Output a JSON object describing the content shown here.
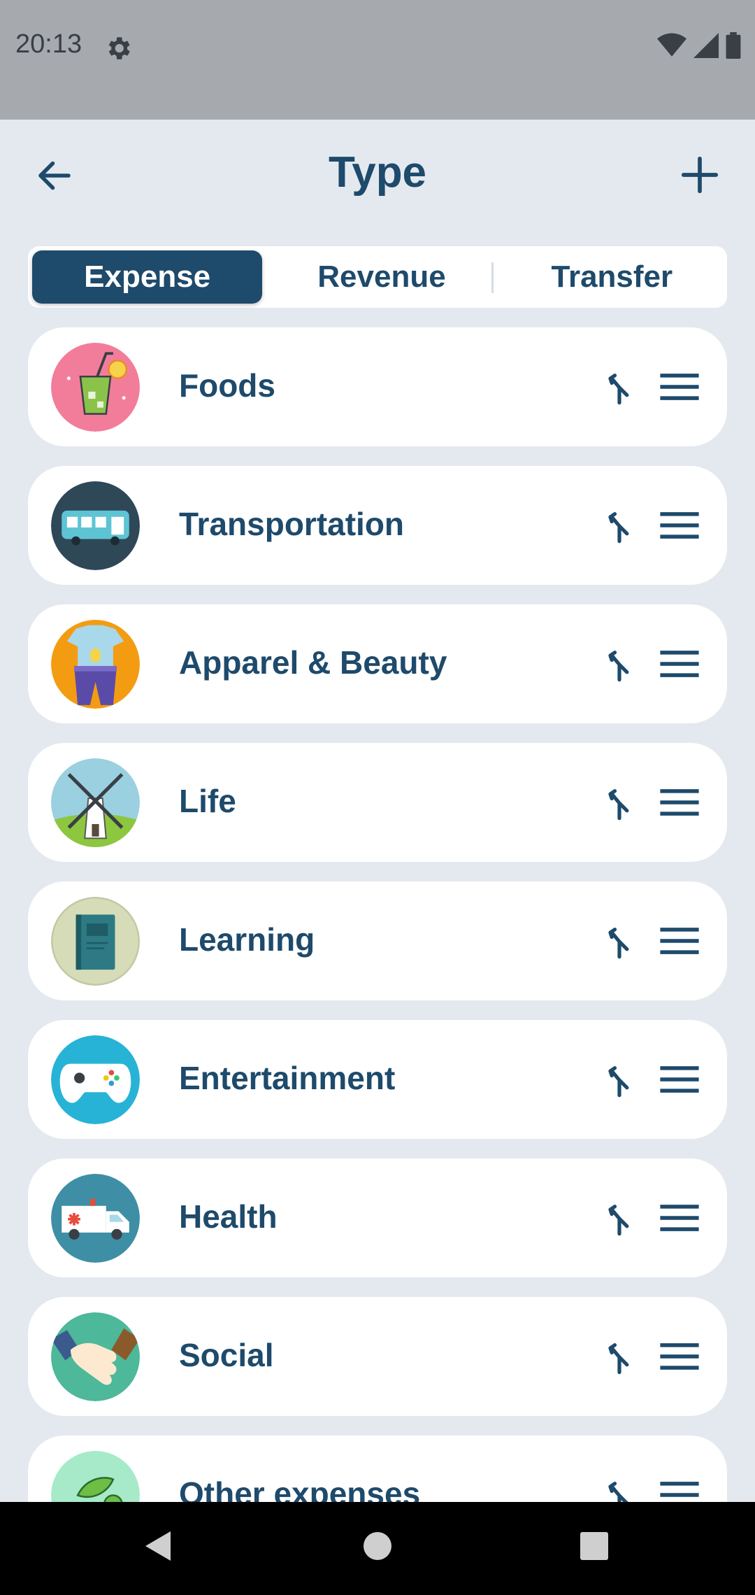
{
  "status_bar": {
    "time": "20:13"
  },
  "app_bar": {
    "title": "Type"
  },
  "tabs": [
    {
      "label": "Expense",
      "active": true
    },
    {
      "label": "Revenue",
      "active": false
    },
    {
      "label": "Transfer",
      "active": false
    }
  ],
  "categories": [
    {
      "label": "Foods",
      "icon": "drink-icon"
    },
    {
      "label": "Transportation",
      "icon": "bus-icon"
    },
    {
      "label": "Apparel & Beauty",
      "icon": "clothes-icon"
    },
    {
      "label": "Life",
      "icon": "windmill-icon"
    },
    {
      "label": "Learning",
      "icon": "book-icon"
    },
    {
      "label": "Entertainment",
      "icon": "gamepad-icon"
    },
    {
      "label": "Health",
      "icon": "ambulance-icon"
    },
    {
      "label": "Social",
      "icon": "handshake-icon"
    },
    {
      "label": "Other expenses",
      "icon": "leaf-icon"
    }
  ],
  "colors": {
    "primary": "#1E4A6B",
    "background": "#E4E9EF",
    "card": "#FFFFFF",
    "status_bar": "#A6A9AE"
  }
}
